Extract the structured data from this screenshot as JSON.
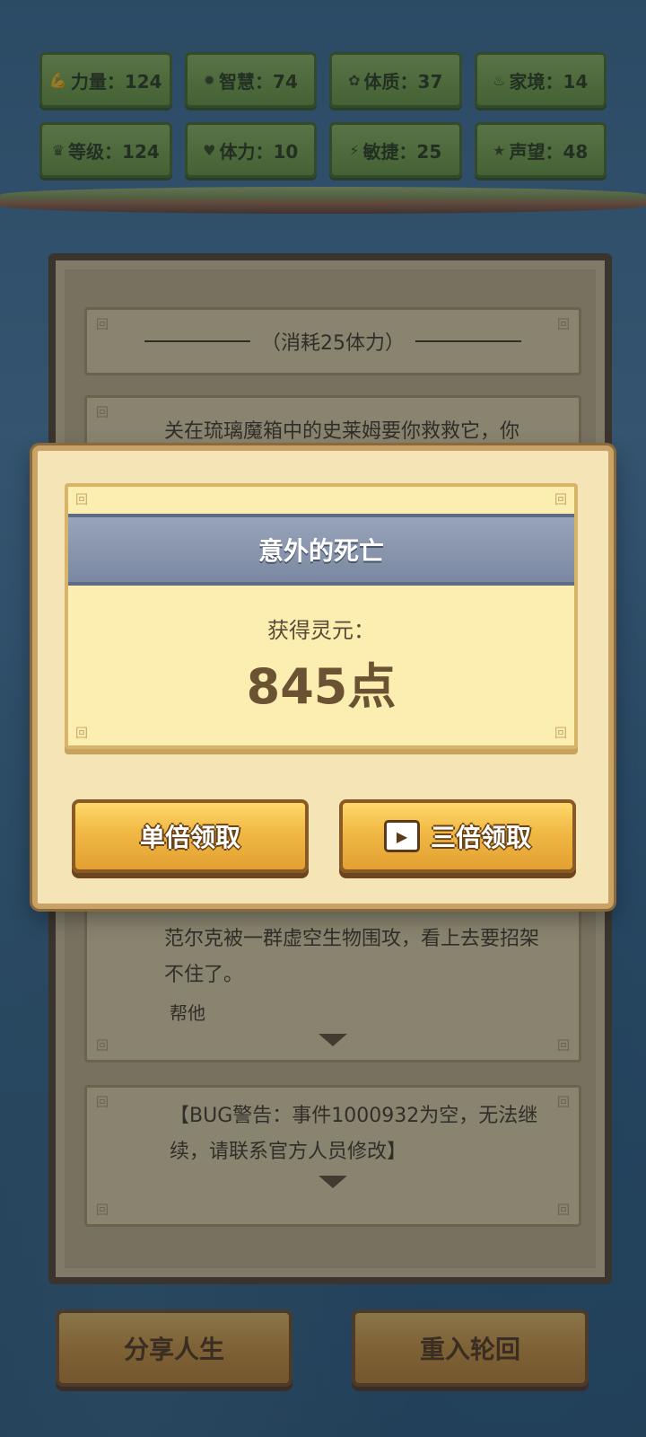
{
  "stats": [
    {
      "icon_name": "muscle-icon",
      "icon": "💪",
      "label": "力量：124"
    },
    {
      "icon_name": "bulb-icon",
      "icon": "✹",
      "label": "智慧：74"
    },
    {
      "icon_name": "body-icon",
      "icon": "✿",
      "label": "体质：37"
    },
    {
      "icon_name": "family-icon",
      "icon": "♨",
      "label": "家境：14"
    },
    {
      "icon_name": "crown-icon",
      "icon": "♛",
      "label": "等级：124"
    },
    {
      "icon_name": "heart-icon",
      "icon": "♥",
      "label": "体力：10"
    },
    {
      "icon_name": "lightning-icon",
      "icon": "⚡",
      "label": "敏捷：25"
    },
    {
      "icon_name": "star-icon",
      "icon": "★",
      "label": "声望：48"
    }
  ],
  "events": {
    "cost_text": "（消耗25体力）",
    "slime_text": "关在琉璃魔箱中的史莱姆要你救救它，你",
    "falke_text": "范尔克被一群虚空生物围攻，看上去要招架不住了。",
    "falke_choice": "帮他",
    "bug_text": "【BUG警告：事件1000932为空，无法继续，请联系官方人员修改】"
  },
  "modal": {
    "title": "意外的死亡",
    "reward_label": "获得灵元：",
    "reward_value": "845点",
    "single_button": "单倍领取",
    "triple_button": "三倍领取"
  },
  "bottom": {
    "share_button": "分享人生",
    "restart_button": "重入轮回"
  }
}
